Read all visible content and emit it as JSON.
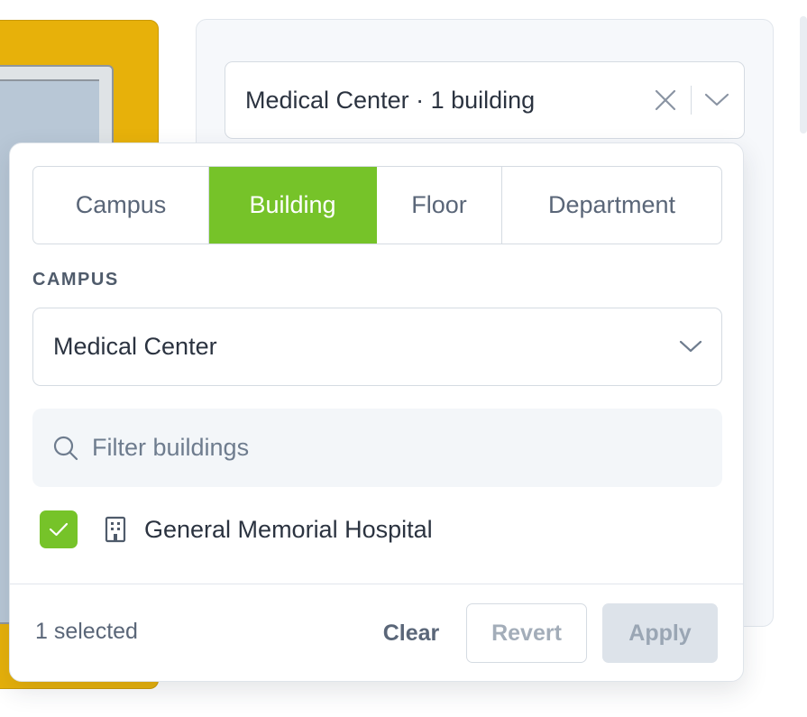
{
  "trigger": {
    "value": "Medical Center · 1 building"
  },
  "tabs": [
    {
      "label": "Campus",
      "active": false
    },
    {
      "label": "Building",
      "active": true
    },
    {
      "label": "Floor",
      "active": false
    },
    {
      "label": "Department",
      "active": false
    }
  ],
  "campus": {
    "section_label": "CAMPUS",
    "selected": "Medical Center"
  },
  "filter": {
    "placeholder": "Filter buildings",
    "value": ""
  },
  "buildings": [
    {
      "label": "General Memorial Hospital",
      "checked": true,
      "icon": "building-icon"
    }
  ],
  "footer": {
    "selected_count": "1 selected",
    "clear_label": "Clear",
    "revert_label": "Revert",
    "apply_label": "Apply"
  },
  "colors": {
    "accent": "#76c329",
    "background_card": "#e7b10a",
    "disabled_button": "#dde3ea"
  }
}
